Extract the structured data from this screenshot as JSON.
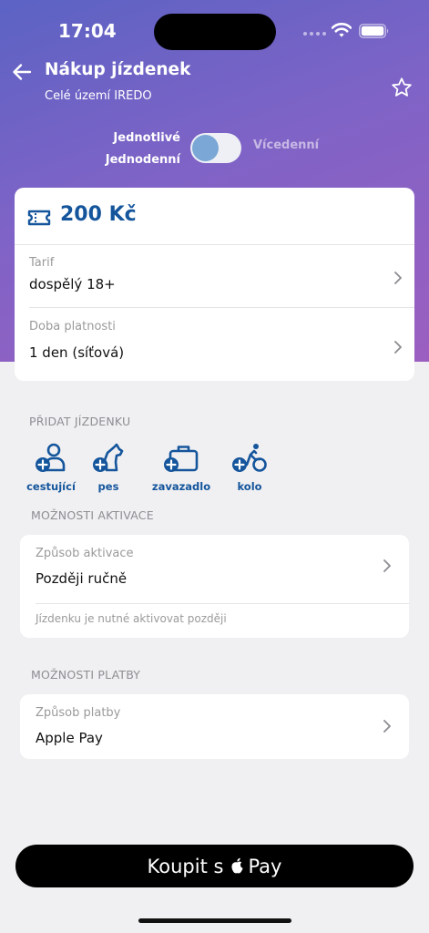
{
  "status_bar": {
    "time": "17:04"
  },
  "header": {
    "title": "Nákup jízdenek",
    "subtitle": "Celé území IREDO"
  },
  "toggle": {
    "left_label_line1": "Jednotlivé",
    "left_label_line2": "Jednodenní",
    "right_label": "Vícedenní",
    "is_on": false
  },
  "ticket": {
    "price": "200 Kč",
    "tariff_label": "Tarif",
    "tariff_value": "dospělý 18+",
    "validity_label": "Doba platnosti",
    "validity_value": "1 den (síťová)"
  },
  "add_ticket": {
    "heading": "PŘIDAT JÍZDENKU",
    "items": [
      {
        "label": "cestující",
        "icon": "add-passenger-icon"
      },
      {
        "label": "pes",
        "icon": "add-dog-icon"
      },
      {
        "label": "zavazadlo",
        "icon": "add-luggage-icon"
      },
      {
        "label": "kolo",
        "icon": "add-bicycle-icon"
      }
    ]
  },
  "activation": {
    "heading": "MOŽNOSTI AKTIVACE",
    "label": "Způsob aktivace",
    "value": "Později ručně",
    "hint": "Jízdenku je nutné aktivovat později"
  },
  "payment": {
    "heading": "MOŽNOSTI PLATBY",
    "label": "Způsob platby",
    "value": "Apple Pay"
  },
  "buy_button": {
    "prefix": "Koupit s",
    "suffix": "Pay"
  },
  "colors": {
    "accent_blue": "#14559c",
    "gradient_start": "#5b63c4",
    "gradient_end": "#9b5fc0",
    "toggle_knob": "#7aa7d6"
  }
}
